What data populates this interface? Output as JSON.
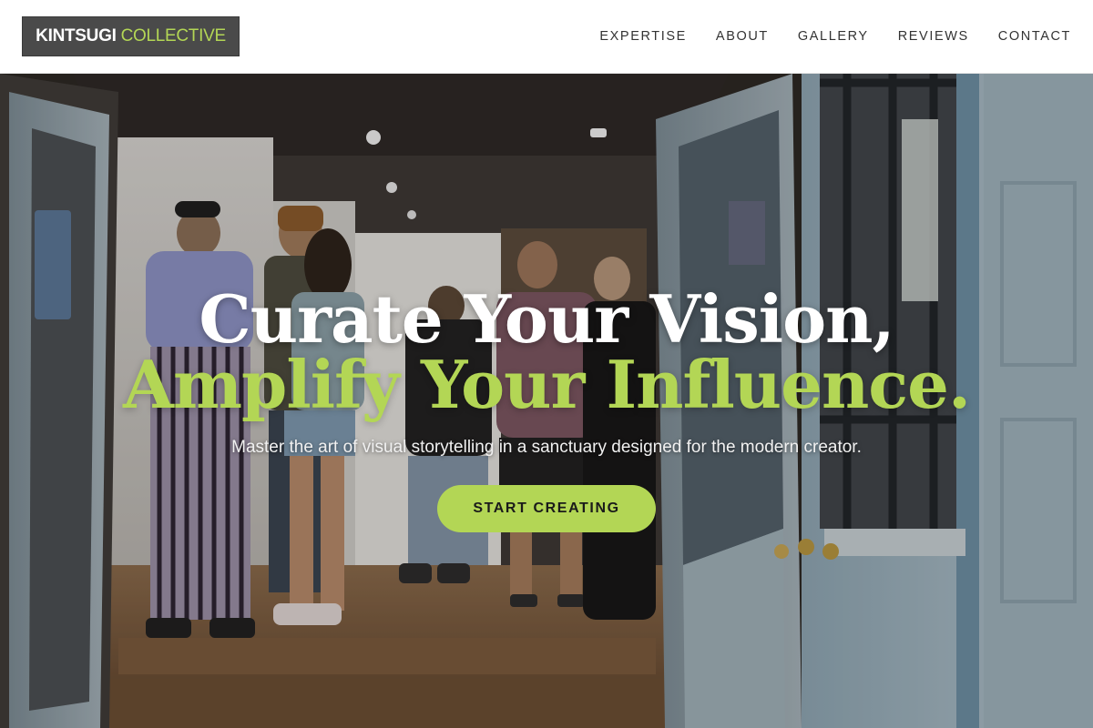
{
  "brand": {
    "name_part1": "KINTSUGI",
    "name_part2": "COLLECTIVE"
  },
  "nav": {
    "items": [
      {
        "label": "EXPERTISE"
      },
      {
        "label": "ABOUT"
      },
      {
        "label": "GALLERY"
      },
      {
        "label": "REVIEWS"
      },
      {
        "label": "CONTACT"
      }
    ]
  },
  "hero": {
    "headline_line1": "Curate Your Vision,",
    "headline_line2": "Amplify Your Influence.",
    "subtitle": "Master the art of visual storytelling in a sanctuary designed for the modern creator.",
    "cta_label": "START CREATING"
  },
  "colors": {
    "accent": "#b3d655",
    "logo_background": "#4a4a4a",
    "nav_text": "#333333"
  }
}
